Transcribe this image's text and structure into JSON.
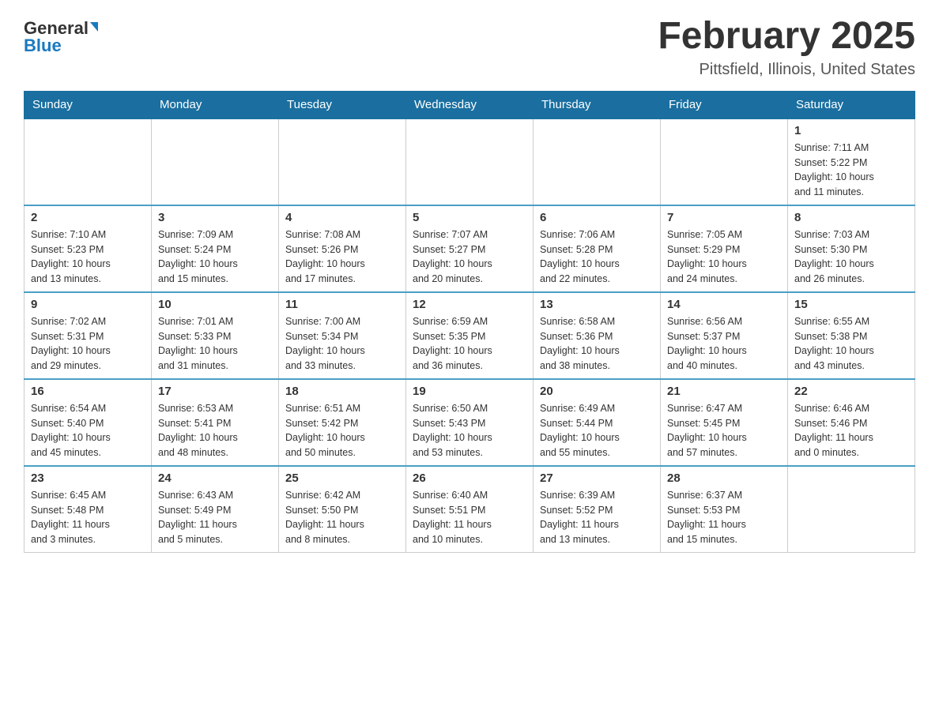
{
  "logo": {
    "general": "General",
    "blue": "Blue"
  },
  "header": {
    "month": "February 2025",
    "location": "Pittsfield, Illinois, United States"
  },
  "weekdays": [
    "Sunday",
    "Monday",
    "Tuesday",
    "Wednesday",
    "Thursday",
    "Friday",
    "Saturday"
  ],
  "weeks": [
    [
      {
        "day": "",
        "info": ""
      },
      {
        "day": "",
        "info": ""
      },
      {
        "day": "",
        "info": ""
      },
      {
        "day": "",
        "info": ""
      },
      {
        "day": "",
        "info": ""
      },
      {
        "day": "",
        "info": ""
      },
      {
        "day": "1",
        "info": "Sunrise: 7:11 AM\nSunset: 5:22 PM\nDaylight: 10 hours\nand 11 minutes."
      }
    ],
    [
      {
        "day": "2",
        "info": "Sunrise: 7:10 AM\nSunset: 5:23 PM\nDaylight: 10 hours\nand 13 minutes."
      },
      {
        "day": "3",
        "info": "Sunrise: 7:09 AM\nSunset: 5:24 PM\nDaylight: 10 hours\nand 15 minutes."
      },
      {
        "day": "4",
        "info": "Sunrise: 7:08 AM\nSunset: 5:26 PM\nDaylight: 10 hours\nand 17 minutes."
      },
      {
        "day": "5",
        "info": "Sunrise: 7:07 AM\nSunset: 5:27 PM\nDaylight: 10 hours\nand 20 minutes."
      },
      {
        "day": "6",
        "info": "Sunrise: 7:06 AM\nSunset: 5:28 PM\nDaylight: 10 hours\nand 22 minutes."
      },
      {
        "day": "7",
        "info": "Sunrise: 7:05 AM\nSunset: 5:29 PM\nDaylight: 10 hours\nand 24 minutes."
      },
      {
        "day": "8",
        "info": "Sunrise: 7:03 AM\nSunset: 5:30 PM\nDaylight: 10 hours\nand 26 minutes."
      }
    ],
    [
      {
        "day": "9",
        "info": "Sunrise: 7:02 AM\nSunset: 5:31 PM\nDaylight: 10 hours\nand 29 minutes."
      },
      {
        "day": "10",
        "info": "Sunrise: 7:01 AM\nSunset: 5:33 PM\nDaylight: 10 hours\nand 31 minutes."
      },
      {
        "day": "11",
        "info": "Sunrise: 7:00 AM\nSunset: 5:34 PM\nDaylight: 10 hours\nand 33 minutes."
      },
      {
        "day": "12",
        "info": "Sunrise: 6:59 AM\nSunset: 5:35 PM\nDaylight: 10 hours\nand 36 minutes."
      },
      {
        "day": "13",
        "info": "Sunrise: 6:58 AM\nSunset: 5:36 PM\nDaylight: 10 hours\nand 38 minutes."
      },
      {
        "day": "14",
        "info": "Sunrise: 6:56 AM\nSunset: 5:37 PM\nDaylight: 10 hours\nand 40 minutes."
      },
      {
        "day": "15",
        "info": "Sunrise: 6:55 AM\nSunset: 5:38 PM\nDaylight: 10 hours\nand 43 minutes."
      }
    ],
    [
      {
        "day": "16",
        "info": "Sunrise: 6:54 AM\nSunset: 5:40 PM\nDaylight: 10 hours\nand 45 minutes."
      },
      {
        "day": "17",
        "info": "Sunrise: 6:53 AM\nSunset: 5:41 PM\nDaylight: 10 hours\nand 48 minutes."
      },
      {
        "day": "18",
        "info": "Sunrise: 6:51 AM\nSunset: 5:42 PM\nDaylight: 10 hours\nand 50 minutes."
      },
      {
        "day": "19",
        "info": "Sunrise: 6:50 AM\nSunset: 5:43 PM\nDaylight: 10 hours\nand 53 minutes."
      },
      {
        "day": "20",
        "info": "Sunrise: 6:49 AM\nSunset: 5:44 PM\nDaylight: 10 hours\nand 55 minutes."
      },
      {
        "day": "21",
        "info": "Sunrise: 6:47 AM\nSunset: 5:45 PM\nDaylight: 10 hours\nand 57 minutes."
      },
      {
        "day": "22",
        "info": "Sunrise: 6:46 AM\nSunset: 5:46 PM\nDaylight: 11 hours\nand 0 minutes."
      }
    ],
    [
      {
        "day": "23",
        "info": "Sunrise: 6:45 AM\nSunset: 5:48 PM\nDaylight: 11 hours\nand 3 minutes."
      },
      {
        "day": "24",
        "info": "Sunrise: 6:43 AM\nSunset: 5:49 PM\nDaylight: 11 hours\nand 5 minutes."
      },
      {
        "day": "25",
        "info": "Sunrise: 6:42 AM\nSunset: 5:50 PM\nDaylight: 11 hours\nand 8 minutes."
      },
      {
        "day": "26",
        "info": "Sunrise: 6:40 AM\nSunset: 5:51 PM\nDaylight: 11 hours\nand 10 minutes."
      },
      {
        "day": "27",
        "info": "Sunrise: 6:39 AM\nSunset: 5:52 PM\nDaylight: 11 hours\nand 13 minutes."
      },
      {
        "day": "28",
        "info": "Sunrise: 6:37 AM\nSunset: 5:53 PM\nDaylight: 11 hours\nand 15 minutes."
      },
      {
        "day": "",
        "info": ""
      }
    ]
  ]
}
